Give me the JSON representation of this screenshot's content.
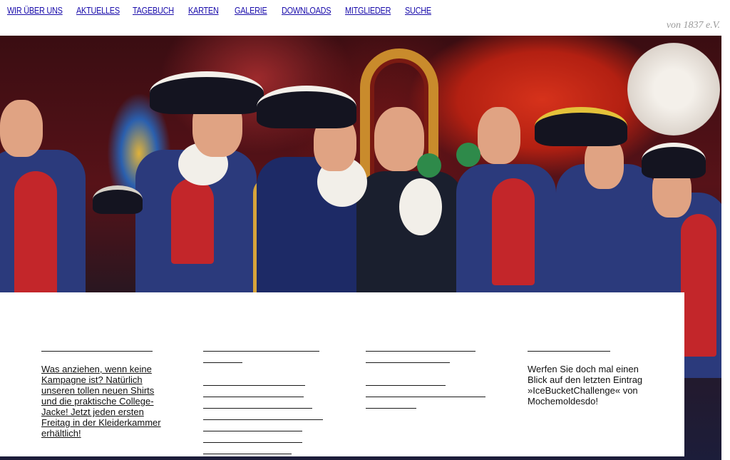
{
  "nav": {
    "items": [
      {
        "label": "WIR ÜBER UNS"
      },
      {
        "label": "AKTUELLES"
      },
      {
        "label": "TAGEBUCH"
      },
      {
        "label": "KARTEN"
      },
      {
        "label": "GALERIE"
      },
      {
        "label": "DOWNLOADS"
      },
      {
        "label": "MITGLIEDER"
      },
      {
        "label": "SUCHE"
      }
    ],
    "tagline": "von 1837 e.V."
  },
  "hero": {
    "icon": "hero-photo"
  },
  "columns": [
    {
      "text": "Was anziehen, wenn keine Kampagne ist? Natürlich unseren tollen neuen Shirts und die praktische College-Jacke!  Jetzt jeden ersten Freitag in der Kleiderkammer erhältlich!"
    },
    {
      "text": ""
    },
    {
      "text": ""
    },
    {
      "text": "Werfen Sie doch mal einen Blick auf den letzten Eintrag »IceBucketChallenge« von Mochemoldesdo!"
    }
  ],
  "colors": {
    "link": "#1a0dab",
    "tagline": "#9a9a9a"
  }
}
